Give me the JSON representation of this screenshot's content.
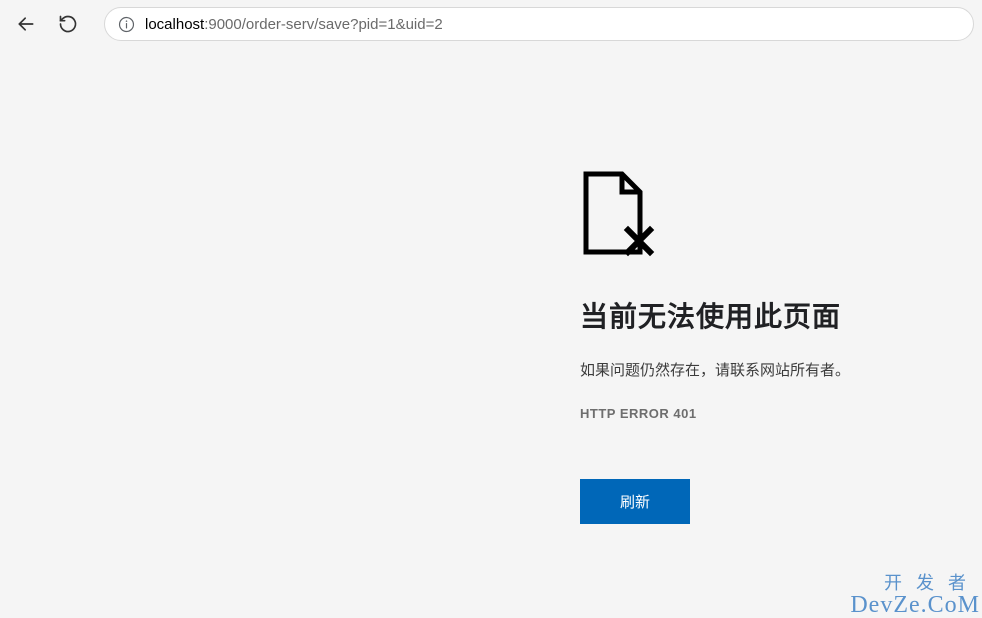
{
  "toolbar": {
    "url_host": "localhost",
    "url_rest": ":9000/order-serv/save?pid=1&uid=2"
  },
  "error": {
    "title": "当前无法使用此页面",
    "message": "如果问题仍然存在，请联系网站所有者。",
    "code": "HTTP ERROR 401",
    "reload_label": "刷新"
  },
  "watermark": {
    "line1": "开发者",
    "line2": "DevZe.CoM"
  }
}
